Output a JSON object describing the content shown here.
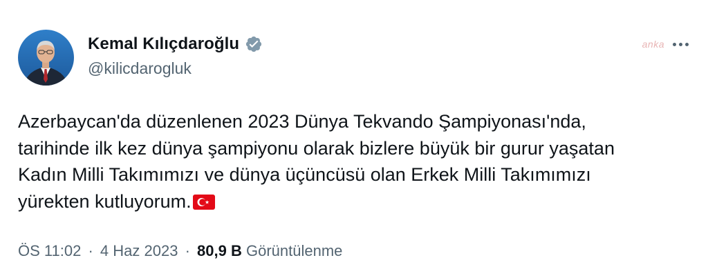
{
  "author": {
    "display_name": "Kemal Kılıçdaroğlu",
    "handle": "@kilicdarogluk",
    "verified": true
  },
  "watermark": "anka",
  "tweet": {
    "lines": [
      "Azerbaycan'da düzenlenen 2023 Dünya Tekvando Şampiyonası'nda,",
      "tarihinde ilk kez dünya şampiyonu olarak bizlere büyük bir gurur yaşatan",
      "Kadın Milli Takımımızı ve dünya üçüncüsü olan Erkek Milli Takımımızı",
      "yürekten kutluyorum."
    ],
    "emoji": "turkey-flag"
  },
  "meta": {
    "time": "ÖS 11:02",
    "separator": "·",
    "date": "4 Haz 2023",
    "views_count": "80,9 B",
    "views_label": "Görüntülenme"
  },
  "colors": {
    "text": "#0f1419",
    "secondary": "#536471",
    "verified_badge": "#829aab",
    "flag_red": "#e30a17"
  }
}
